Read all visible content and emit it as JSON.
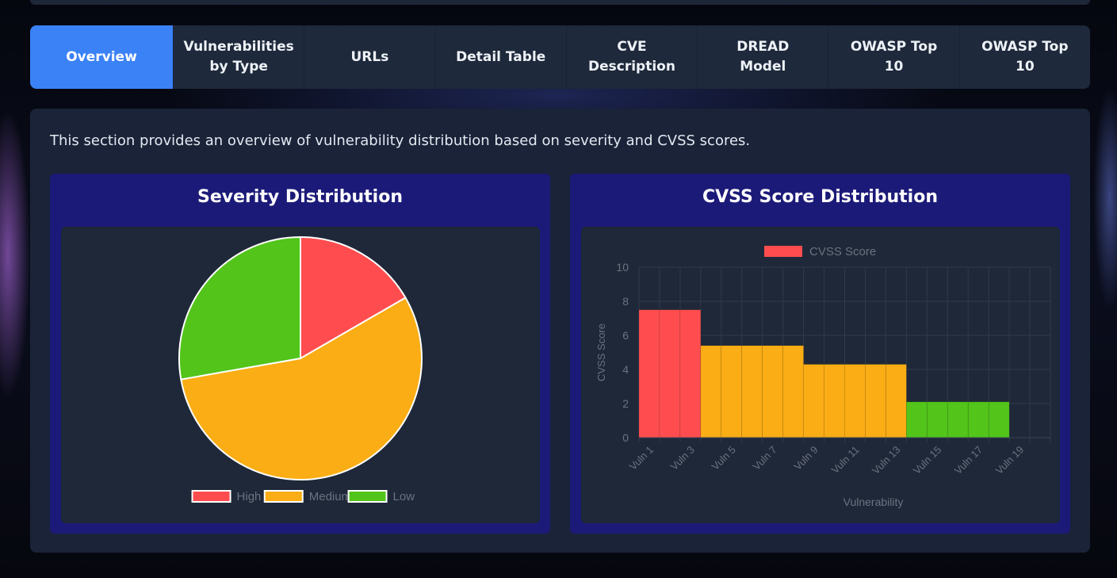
{
  "tabs": [
    {
      "label": "Overview",
      "active": true
    },
    {
      "label": "Vulnerabilities\nby Type",
      "active": false
    },
    {
      "label": "URLs",
      "active": false
    },
    {
      "label": "Detail Table",
      "active": false
    },
    {
      "label": "CVE\nDescription",
      "active": false
    },
    {
      "label": "DREAD\nModel",
      "active": false
    },
    {
      "label": "OWASP Top\n10",
      "active": false
    },
    {
      "label": "OWASP Top\n10",
      "active": false
    }
  ],
  "overview": {
    "intro": "This section provides an overview of vulnerability distribution based on severity and CVSS scores."
  },
  "colors": {
    "high": "#ff4d4f",
    "medium": "#faad14",
    "low": "#52c41a",
    "active_tab": "#3b82f6"
  },
  "chart_data": [
    {
      "type": "pie",
      "title": "Severity Distribution",
      "categories": [
        "High",
        "Medium",
        "Low"
      ],
      "values": [
        3,
        10,
        5
      ],
      "colors": [
        "#ff4d4f",
        "#faad14",
        "#52c41a"
      ],
      "legend": "bottom"
    },
    {
      "type": "bar",
      "title": "CVSS Score Distribution",
      "xlabel": "Vulnerability",
      "ylabel": "CVSS Score",
      "ylim": [
        0,
        10
      ],
      "yticks": [
        0,
        2,
        4,
        6,
        8,
        10
      ],
      "grid": true,
      "legend": "top",
      "categories": [
        "Vuln 1",
        "Vuln 2",
        "Vuln 3",
        "Vuln 4",
        "Vuln 5",
        "Vuln 6",
        "Vuln 7",
        "Vuln 8",
        "Vuln 9",
        "Vuln 10",
        "Vuln 11",
        "Vuln 12",
        "Vuln 13",
        "Vuln 14",
        "Vuln 15",
        "Vuln 16",
        "Vuln 17",
        "Vuln 18",
        "Vuln 19",
        "Vuln 20"
      ],
      "visible_tick_labels": [
        "Vuln 1",
        "Vuln 3",
        "Vuln 5",
        "Vuln 7",
        "Vuln 9",
        "Vuln 11",
        "Vuln 13",
        "Vuln 15",
        "Vuln 17",
        "Vuln 19"
      ],
      "series": [
        {
          "name": "CVSS Score",
          "values": [
            7.5,
            7.5,
            7.5,
            5.4,
            5.4,
            5.4,
            5.4,
            5.4,
            4.3,
            4.3,
            4.3,
            4.3,
            4.3,
            2.1,
            2.1,
            2.1,
            2.1,
            2.1,
            null,
            null
          ],
          "colors": [
            "#ff4d4f",
            "#ff4d4f",
            "#ff4d4f",
            "#faad14",
            "#faad14",
            "#faad14",
            "#faad14",
            "#faad14",
            "#faad14",
            "#faad14",
            "#faad14",
            "#faad14",
            "#faad14",
            "#52c41a",
            "#52c41a",
            "#52c41a",
            "#52c41a",
            "#52c41a",
            null,
            null
          ]
        }
      ]
    }
  ]
}
